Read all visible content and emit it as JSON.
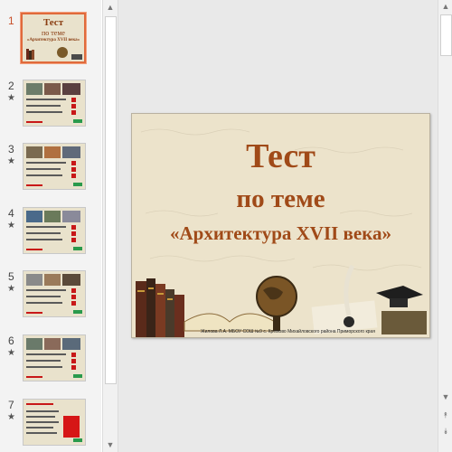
{
  "slides": [
    {
      "number": "1",
      "star": ""
    },
    {
      "number": "2",
      "star": "★"
    },
    {
      "number": "3",
      "star": "★"
    },
    {
      "number": "4",
      "star": "★"
    },
    {
      "number": "5",
      "star": "★"
    },
    {
      "number": "6",
      "star": "★"
    },
    {
      "number": "7",
      "star": "★"
    }
  ],
  "thumb1": {
    "line1": "Тест",
    "line2": "по теме",
    "line3": "«Архитектура XVII века»"
  },
  "slide": {
    "title": "Тест",
    "subtitle": "по теме",
    "topic": "«Архитектура XVII века»",
    "footer": "Жилова Л.А. МБОУ СОШ №9 с. Кремово Михайловского района Приморского края"
  },
  "scroll": {
    "up": "▲",
    "down": "▼",
    "prev_slide": "⯭",
    "next_slide": "⯯"
  }
}
